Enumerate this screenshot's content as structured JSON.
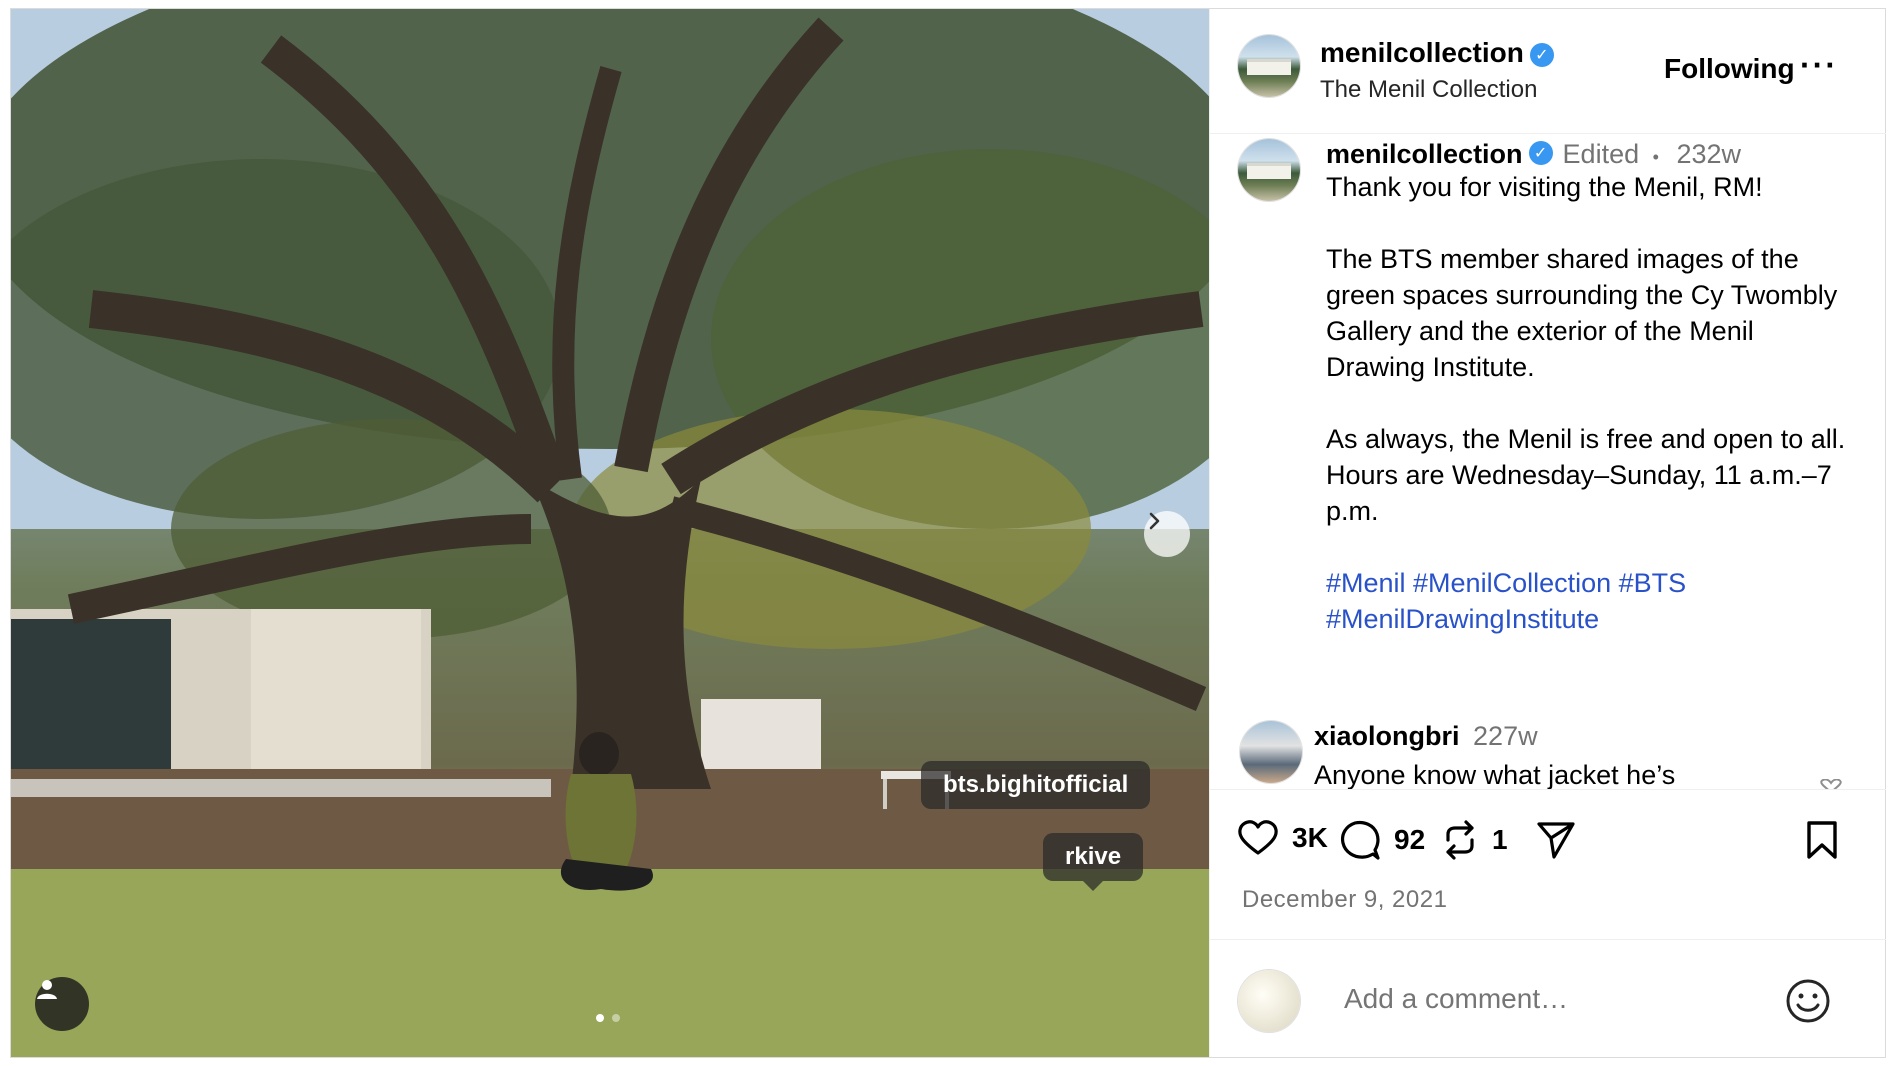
{
  "post": {
    "tags": {
      "first": "bts.bighitofficial",
      "second": "rkive"
    },
    "carousel": {
      "count": 2,
      "active_index": 0
    }
  },
  "header": {
    "username": "menilcollection",
    "full_name": "The Menil Collection",
    "follow_label": "Following",
    "more_label": "···"
  },
  "caption": {
    "username": "menilcollection",
    "edited_label": "Edited",
    "separator": "•",
    "age": "232w",
    "line1": "Thank you for visiting the Menil, RM!",
    "paragraph2": "The BTS member shared images of the green spaces surrounding the Cy Twombly Gallery and the exterior of the Menil Drawing Institute.",
    "paragraph3": "As always, the Menil is free and open to all. Hours are Wednesday–Sunday, 11 a.m.–7 p.m.",
    "hashtags": "#Menil #MenilCollection #BTS #MenilDrawingInstitute"
  },
  "comments": [
    {
      "username": "xiaolongbri",
      "age": "227w",
      "text": "Anyone know what jacket he’s"
    }
  ],
  "actions": {
    "likes": "3K",
    "comments": "92",
    "reposts": "1",
    "icons": [
      "heart-icon",
      "comment-icon",
      "repost-icon",
      "share-icon",
      "bookmark-icon"
    ]
  },
  "date": "December 9, 2021",
  "add_comment": {
    "placeholder": "Add a comment…"
  },
  "colors": {
    "verified": "#3897f0",
    "hashtag": "#2952c9",
    "muted": "#737373"
  }
}
